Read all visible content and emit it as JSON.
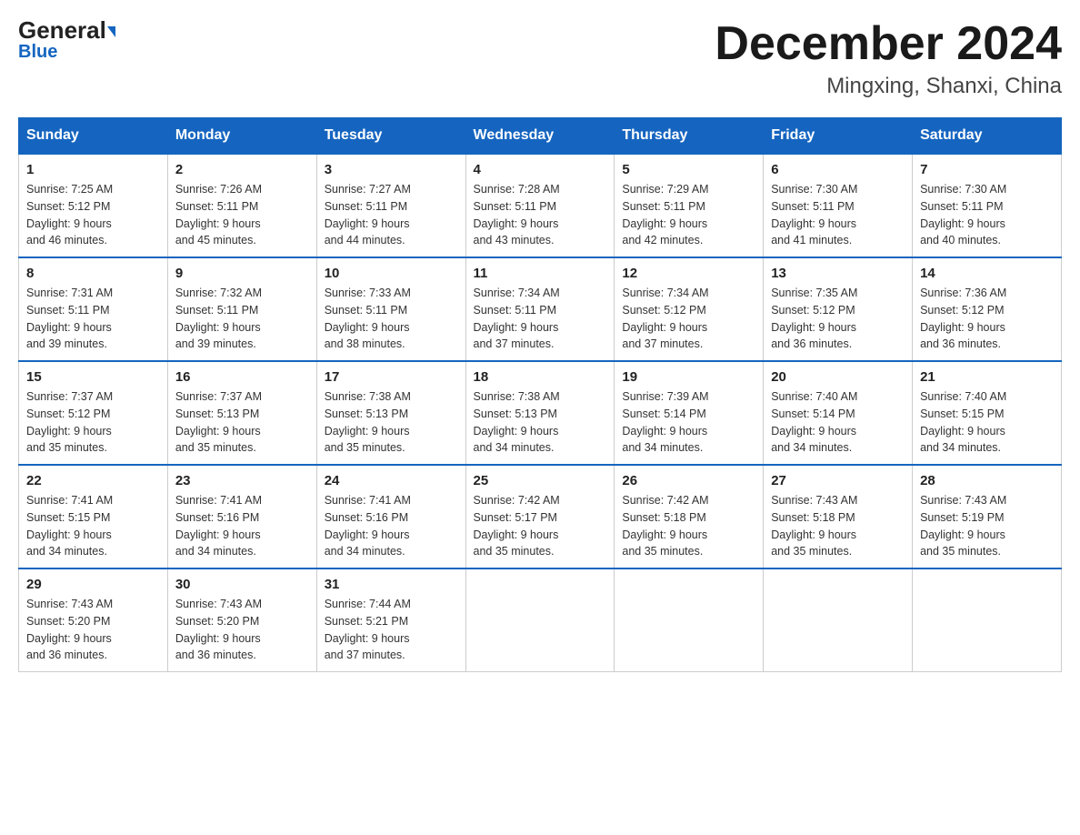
{
  "header": {
    "month_title": "December 2024",
    "location": "Mingxing, Shanxi, China",
    "logo_general": "General",
    "logo_blue": "Blue"
  },
  "days_of_week": [
    "Sunday",
    "Monday",
    "Tuesday",
    "Wednesday",
    "Thursday",
    "Friday",
    "Saturday"
  ],
  "weeks": [
    [
      {
        "day": "1",
        "sunrise": "7:25 AM",
        "sunset": "5:12 PM",
        "daylight": "9 hours and 46 minutes."
      },
      {
        "day": "2",
        "sunrise": "7:26 AM",
        "sunset": "5:11 PM",
        "daylight": "9 hours and 45 minutes."
      },
      {
        "day": "3",
        "sunrise": "7:27 AM",
        "sunset": "5:11 PM",
        "daylight": "9 hours and 44 minutes."
      },
      {
        "day": "4",
        "sunrise": "7:28 AM",
        "sunset": "5:11 PM",
        "daylight": "9 hours and 43 minutes."
      },
      {
        "day": "5",
        "sunrise": "7:29 AM",
        "sunset": "5:11 PM",
        "daylight": "9 hours and 42 minutes."
      },
      {
        "day": "6",
        "sunrise": "7:30 AM",
        "sunset": "5:11 PM",
        "daylight": "9 hours and 41 minutes."
      },
      {
        "day": "7",
        "sunrise": "7:30 AM",
        "sunset": "5:11 PM",
        "daylight": "9 hours and 40 minutes."
      }
    ],
    [
      {
        "day": "8",
        "sunrise": "7:31 AM",
        "sunset": "5:11 PM",
        "daylight": "9 hours and 39 minutes."
      },
      {
        "day": "9",
        "sunrise": "7:32 AM",
        "sunset": "5:11 PM",
        "daylight": "9 hours and 39 minutes."
      },
      {
        "day": "10",
        "sunrise": "7:33 AM",
        "sunset": "5:11 PM",
        "daylight": "9 hours and 38 minutes."
      },
      {
        "day": "11",
        "sunrise": "7:34 AM",
        "sunset": "5:11 PM",
        "daylight": "9 hours and 37 minutes."
      },
      {
        "day": "12",
        "sunrise": "7:34 AM",
        "sunset": "5:12 PM",
        "daylight": "9 hours and 37 minutes."
      },
      {
        "day": "13",
        "sunrise": "7:35 AM",
        "sunset": "5:12 PM",
        "daylight": "9 hours and 36 minutes."
      },
      {
        "day": "14",
        "sunrise": "7:36 AM",
        "sunset": "5:12 PM",
        "daylight": "9 hours and 36 minutes."
      }
    ],
    [
      {
        "day": "15",
        "sunrise": "7:37 AM",
        "sunset": "5:12 PM",
        "daylight": "9 hours and 35 minutes."
      },
      {
        "day": "16",
        "sunrise": "7:37 AM",
        "sunset": "5:13 PM",
        "daylight": "9 hours and 35 minutes."
      },
      {
        "day": "17",
        "sunrise": "7:38 AM",
        "sunset": "5:13 PM",
        "daylight": "9 hours and 35 minutes."
      },
      {
        "day": "18",
        "sunrise": "7:38 AM",
        "sunset": "5:13 PM",
        "daylight": "9 hours and 34 minutes."
      },
      {
        "day": "19",
        "sunrise": "7:39 AM",
        "sunset": "5:14 PM",
        "daylight": "9 hours and 34 minutes."
      },
      {
        "day": "20",
        "sunrise": "7:40 AM",
        "sunset": "5:14 PM",
        "daylight": "9 hours and 34 minutes."
      },
      {
        "day": "21",
        "sunrise": "7:40 AM",
        "sunset": "5:15 PM",
        "daylight": "9 hours and 34 minutes."
      }
    ],
    [
      {
        "day": "22",
        "sunrise": "7:41 AM",
        "sunset": "5:15 PM",
        "daylight": "9 hours and 34 minutes."
      },
      {
        "day": "23",
        "sunrise": "7:41 AM",
        "sunset": "5:16 PM",
        "daylight": "9 hours and 34 minutes."
      },
      {
        "day": "24",
        "sunrise": "7:41 AM",
        "sunset": "5:16 PM",
        "daylight": "9 hours and 34 minutes."
      },
      {
        "day": "25",
        "sunrise": "7:42 AM",
        "sunset": "5:17 PM",
        "daylight": "9 hours and 35 minutes."
      },
      {
        "day": "26",
        "sunrise": "7:42 AM",
        "sunset": "5:18 PM",
        "daylight": "9 hours and 35 minutes."
      },
      {
        "day": "27",
        "sunrise": "7:43 AM",
        "sunset": "5:18 PM",
        "daylight": "9 hours and 35 minutes."
      },
      {
        "day": "28",
        "sunrise": "7:43 AM",
        "sunset": "5:19 PM",
        "daylight": "9 hours and 35 minutes."
      }
    ],
    [
      {
        "day": "29",
        "sunrise": "7:43 AM",
        "sunset": "5:20 PM",
        "daylight": "9 hours and 36 minutes."
      },
      {
        "day": "30",
        "sunrise": "7:43 AM",
        "sunset": "5:20 PM",
        "daylight": "9 hours and 36 minutes."
      },
      {
        "day": "31",
        "sunrise": "7:44 AM",
        "sunset": "5:21 PM",
        "daylight": "9 hours and 37 minutes."
      },
      null,
      null,
      null,
      null
    ]
  ],
  "labels": {
    "sunrise": "Sunrise:",
    "sunset": "Sunset:",
    "daylight": "Daylight:"
  }
}
